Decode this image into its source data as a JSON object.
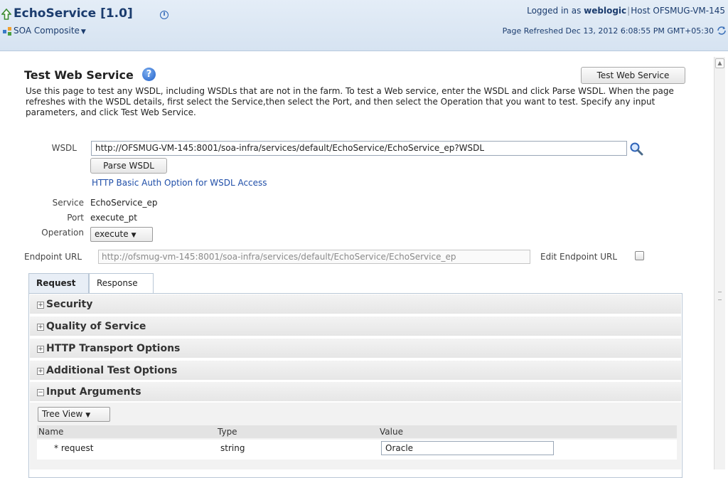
{
  "header": {
    "app_title": "EchoService [1.0]",
    "component_menu": "SOA Composite",
    "login_prefix": "Logged in as",
    "user": "weblogic",
    "host_label": "Host",
    "host": "OFSMUG-VM-145",
    "page_refreshed": "Page Refreshed Dec 13, 2012 6:08:55 PM GMT+05:30"
  },
  "page": {
    "title": "Test Web Service",
    "test_button": "Test Web Service",
    "description": "Use this page to test any WSDL, including WSDLs that are not in the farm. To test a Web service, enter the WSDL and click Parse WSDL. When the page refreshes with the WSDL details, first select the Service,then select the Port, and then select the Operation that you want to test. Specify any input parameters, and click Test Web Service."
  },
  "form": {
    "wsdl_label": "WSDL",
    "wsdl_value": "http://OFSMUG-VM-145:8001/soa-infra/services/default/EchoService/EchoService_ep?WSDL",
    "parse_button": "Parse WSDL",
    "auth_link": "HTTP Basic Auth Option for WSDL Access",
    "service_label": "Service",
    "service_value": "EchoService_ep",
    "port_label": "Port",
    "port_value": "execute_pt",
    "operation_label": "Operation",
    "operation_value": "execute",
    "endpoint_label": "Endpoint URL",
    "endpoint_value": "http://ofsmug-vm-145:8001/soa-infra/services/default/EchoService/EchoService_ep",
    "edit_endpoint_label": "Edit Endpoint URL"
  },
  "tabs": [
    {
      "label": "Request"
    },
    {
      "label": "Response"
    }
  ],
  "sections": [
    {
      "label": "Security",
      "sign": "+"
    },
    {
      "label": "Quality of Service",
      "sign": "+"
    },
    {
      "label": "HTTP Transport Options",
      "sign": "+"
    },
    {
      "label": "Additional Test Options",
      "sign": "+"
    },
    {
      "label": "Input Arguments",
      "sign": "−"
    }
  ],
  "arguments": {
    "view_select": "Tree View",
    "columns": [
      "Name",
      "Type",
      "Value"
    ],
    "rows": [
      {
        "name": "* request",
        "type": "string",
        "value": "Oracle"
      }
    ]
  }
}
